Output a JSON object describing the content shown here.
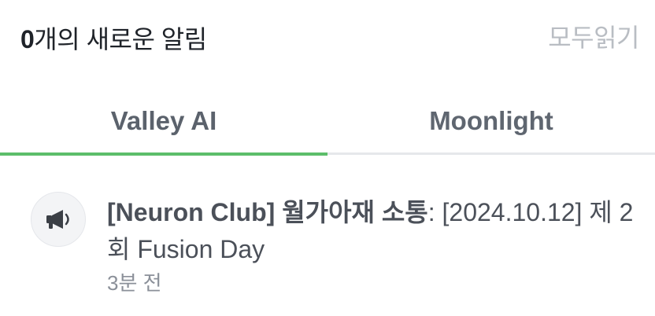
{
  "header": {
    "count": "0",
    "title_suffix": "개의 새로운 알림",
    "mark_all_read": "모두읽기"
  },
  "tabs": [
    {
      "label": "Valley AI",
      "active": true
    },
    {
      "label": "Moonlight",
      "active": false
    }
  ],
  "notifications": [
    {
      "icon": "megaphone-icon",
      "source": "[Neuron Club] 월가아재 소통",
      "separator": ": ",
      "message": "[2024.10.12] 제 2회 Fusion Day",
      "time": "3분 전"
    }
  ],
  "colors": {
    "accent": "#5cbe6a",
    "muted": "#b9bdc3",
    "tab_text": "#5f6670"
  }
}
